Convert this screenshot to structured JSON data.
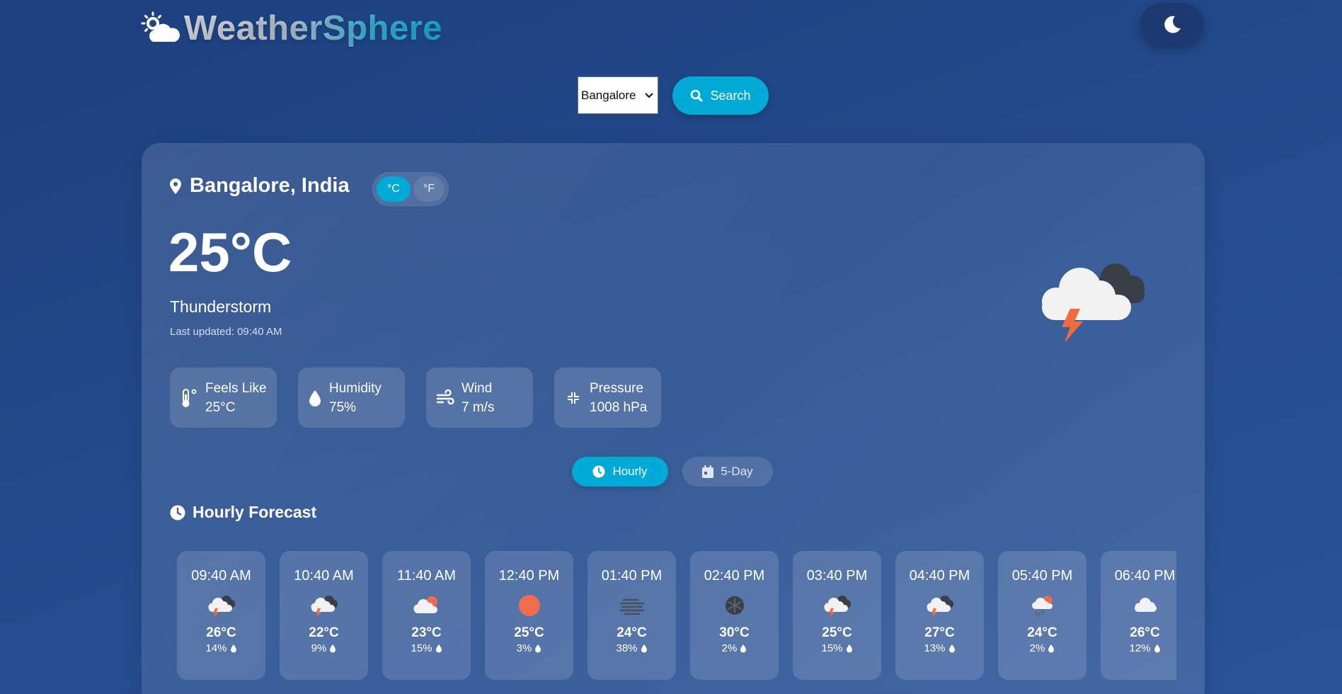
{
  "header": {
    "app_name": "WeatherSphere",
    "logo_icon": "sun-cloud-icon",
    "theme_toggle_icon": "moon-icon"
  },
  "search": {
    "selected_city": "Bangalore",
    "button_label": "Search",
    "button_icon": "search-icon"
  },
  "current": {
    "location": "Bangalore, India",
    "unit_c": "°C",
    "unit_f": "°F",
    "active_unit": "C",
    "temperature": "25°C",
    "condition": "Thunderstorm",
    "last_updated": "Last updated: 09:40 AM",
    "condition_icon": "thunderstorm-icon"
  },
  "stats": [
    {
      "label": "Feels Like",
      "value": "25°C",
      "icon": "thermometer-icon"
    },
    {
      "label": "Humidity",
      "value": "75%",
      "icon": "droplet-icon"
    },
    {
      "label": "Wind",
      "value": "7 m/s",
      "icon": "wind-icon"
    },
    {
      "label": "Pressure",
      "value": "1008 hPa",
      "icon": "pressure-icon"
    }
  ],
  "tabs": {
    "hourly": "Hourly",
    "five_day": "5-Day",
    "active": "hourly"
  },
  "hourly_title": "Hourly Forecast",
  "hourly": [
    {
      "time": "09:40 AM",
      "temp": "26°C",
      "pop": "14%",
      "icon": "thunderstorm-icon"
    },
    {
      "time": "10:40 AM",
      "temp": "22°C",
      "pop": "9%",
      "icon": "thunderstorm-icon"
    },
    {
      "time": "11:40 AM",
      "temp": "23°C",
      "pop": "15%",
      "icon": "partly-cloudy-icon"
    },
    {
      "time": "12:40 PM",
      "temp": "25°C",
      "pop": "3%",
      "icon": "sun-icon"
    },
    {
      "time": "01:40 PM",
      "temp": "24°C",
      "pop": "38%",
      "icon": "fog-icon"
    },
    {
      "time": "02:40 PM",
      "temp": "30°C",
      "pop": "2%",
      "icon": "snow-icon"
    },
    {
      "time": "03:40 PM",
      "temp": "25°C",
      "pop": "15%",
      "icon": "thunderstorm-icon"
    },
    {
      "time": "04:40 PM",
      "temp": "27°C",
      "pop": "13%",
      "icon": "thunderstorm-icon"
    },
    {
      "time": "05:40 PM",
      "temp": "24°C",
      "pop": "2%",
      "icon": "rain-sun-icon"
    },
    {
      "time": "06:40 PM",
      "temp": "26°C",
      "pop": "12%",
      "icon": "cloud-icon"
    }
  ],
  "colors": {
    "accent": "#00aad6",
    "background": "#1f4482",
    "storm_bolt": "#f26b3a",
    "sun": "#f26b4f"
  }
}
